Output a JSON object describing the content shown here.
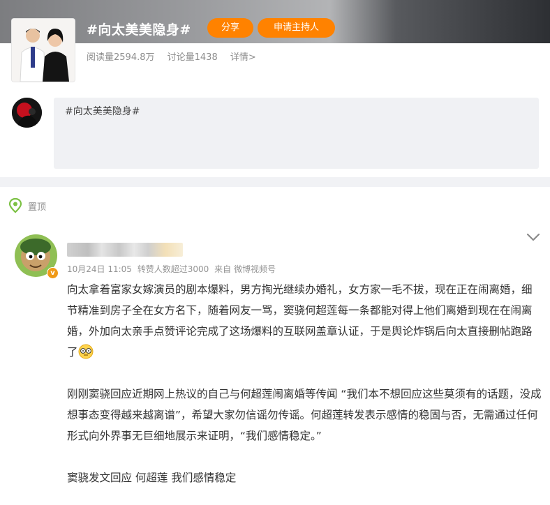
{
  "topic": {
    "title": "#向太美美隐身#",
    "share_label": "分享",
    "host_label": "申请主持人",
    "reads": "阅读量2594.8万",
    "discussions": "讨论量1438",
    "details": "详情>"
  },
  "composer": {
    "text": "#向太美美隐身#"
  },
  "pinned": {
    "label": "置顶"
  },
  "post": {
    "date": "10月24日 11:05",
    "reposts": "转赞人数超过3000",
    "source_prefix": "来自",
    "source": "微博视频号",
    "verified_glyph": "v",
    "paragraphs": [
      "向太拿着富家女嫁演员的剧本爆料，男方掏光继续办婚礼，女方家一毛不拔，现在正在闹离婚，细节精准到房子全在女方名下，随着网友一骂，窦骁何超莲每一条都能对得上他们离婚到现在在闹离婚，外加向太亲手点赞评论完成了这场爆料的互联网盖章认证，于是舆论炸锅后向太直接删帖跑路了",
      "刚刚窦骁回应近期网上热议的自己与何超莲闹离婚等传闻 “我们本不想回应这些莫须有的话题，没成想事态变得越来越离谱”，希望大家勿信谣勿传谣。何超莲转发表示感情的稳固与否，无需通过任何形式向外界事无巨细地展示来证明，“我们感情稳定。”",
      "窦骁发文回应 何超莲 我们感情稳定"
    ]
  },
  "colors": {
    "accent": "#ff8200",
    "pin_green": "#7cc144",
    "verified": "#f09a17"
  },
  "icons": {
    "pin": "pin-location-icon",
    "chevron": "chevron-down-icon",
    "emoji": "speechless-emoji-icon"
  }
}
